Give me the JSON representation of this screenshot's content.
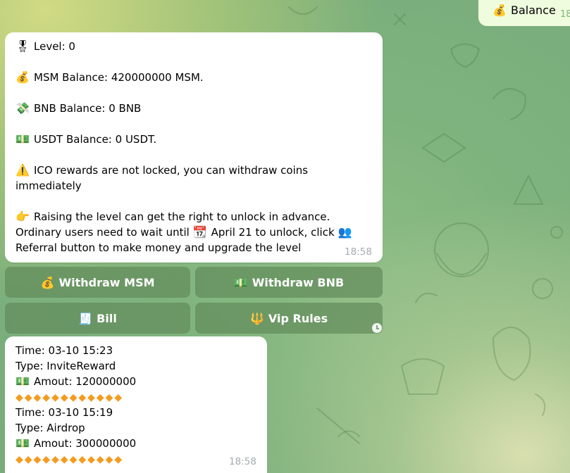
{
  "outgoing": {
    "icon": "💰",
    "text": "Balance",
    "time": "18"
  },
  "balance_message": {
    "lines": [
      {
        "icon": "🎖",
        "text": "Level: 0"
      },
      {
        "icon": "💰",
        "text": "MSM Balance: 420000000 MSM."
      },
      {
        "icon": "💸",
        "text": "BNB Balance: 0 BNB"
      },
      {
        "icon": "💵",
        "text": "USDT Balance: 0 USDT."
      },
      {
        "icon": "⚠️",
        "text": "ICO rewards are not locked, you can withdraw coins"
      }
    ],
    "ico_line2": "immediately",
    "raise_icon": "👉",
    "raise_line1": "Raising the level can get the right to unlock in advance.",
    "raise_line2_a": "Ordinary users need to wait until",
    "calendar_icon": "📆",
    "raise_line2_b": "April 21 to unlock, click",
    "people_icon": "👥",
    "raise_line3": "Referral button to make money and upgrade the level",
    "time": "18:58"
  },
  "keyboard": {
    "withdraw_msm": {
      "icon": "💰",
      "label": "Withdraw MSM"
    },
    "withdraw_bnb": {
      "icon": "💵",
      "label": "Withdraw BNB"
    },
    "bill": {
      "icon": "🧾",
      "label": "Bill"
    },
    "vip_rules": {
      "icon": "🔱",
      "label": "Vip Rules"
    }
  },
  "bill_message": {
    "records": [
      {
        "time": "Time: 03-10 15:23",
        "type": "Type: InviteReward",
        "amount_icon": "💵",
        "amount": "Amout: 120000000",
        "diamonds": "◆◆◆◆◆◆◆◆◆◆◆◆"
      },
      {
        "time": "Time: 03-10 15:19",
        "type": "Type: Airdrop",
        "amount_icon": "💵",
        "amount": "Amout: 300000000",
        "diamonds": "◆◆◆◆◆◆◆◆◆◆◆◆"
      }
    ],
    "time": "18:58"
  }
}
